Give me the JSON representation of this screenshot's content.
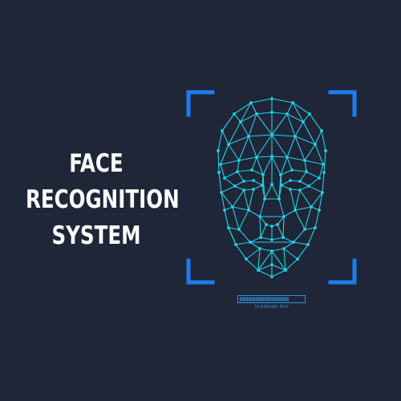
{
  "title": {
    "line1": "FACE",
    "line2": "RECOGNITION",
    "line3": "SYSTEM"
  },
  "scan": {
    "caption": "SCANNING 80%",
    "progress": 0.8
  },
  "colors": {
    "background": "#1f2638",
    "title_text": "#ffffff",
    "bracket": "#1c7df0",
    "mesh": "#22d3e6",
    "progress": "#2f97d8"
  }
}
